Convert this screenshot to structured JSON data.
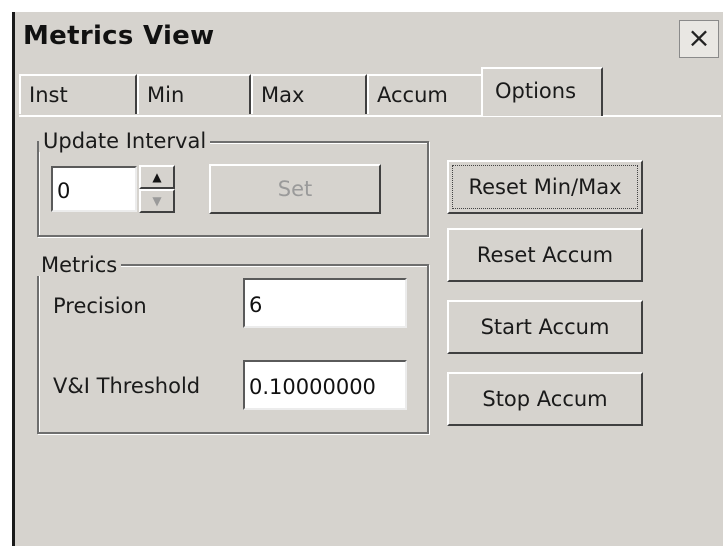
{
  "window": {
    "title": "Metrics View",
    "close_glyph": "×"
  },
  "tabs": [
    {
      "label": "Inst",
      "active": false
    },
    {
      "label": "Min",
      "active": false
    },
    {
      "label": "Max",
      "active": false
    },
    {
      "label": "Accum",
      "active": false
    },
    {
      "label": "Options",
      "active": true
    }
  ],
  "update_interval": {
    "legend": "Update Interval",
    "value": "0",
    "spin_up_glyph": "▲",
    "spin_down_glyph": "▼",
    "set_label": "Set"
  },
  "metrics": {
    "legend": "Metrics",
    "precision_label": "Precision",
    "precision_value": "6",
    "threshold_label": "V&I Threshold",
    "threshold_value": "0.10000000"
  },
  "actions": {
    "reset_min_max": "Reset Min/Max",
    "reset_accum": "Reset Accum",
    "start_accum": "Start Accum",
    "stop_accum": "Stop Accum"
  },
  "icons": {
    "close": "close-icon",
    "spin_up": "arrow-up-icon",
    "spin_down": "arrow-down-icon"
  },
  "colors": {
    "face": "#d6d3ce",
    "disabled_text": "#9a9a9a"
  }
}
